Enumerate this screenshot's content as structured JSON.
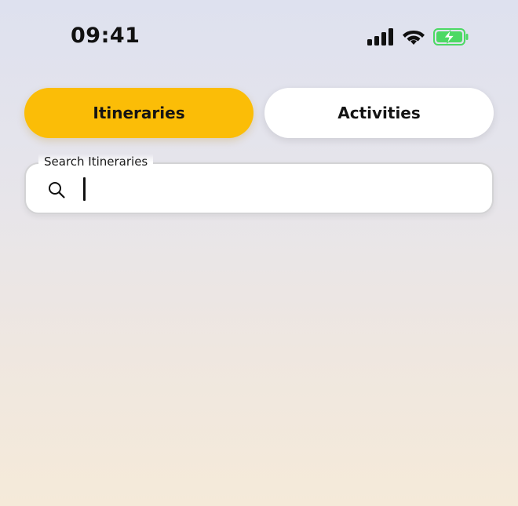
{
  "status_bar": {
    "time": "09:41",
    "icons": [
      "cellular-signal-icon",
      "wifi-icon",
      "battery-charging-icon"
    ],
    "battery_color": "#4cd964"
  },
  "tabs": [
    {
      "label": "Itineraries",
      "selected": true,
      "color": "#fbbd07"
    },
    {
      "label": "Activities",
      "selected": false,
      "color": "#ffffff"
    }
  ],
  "search": {
    "label": "Search Itineraries",
    "value": "",
    "icon": "search-icon"
  }
}
